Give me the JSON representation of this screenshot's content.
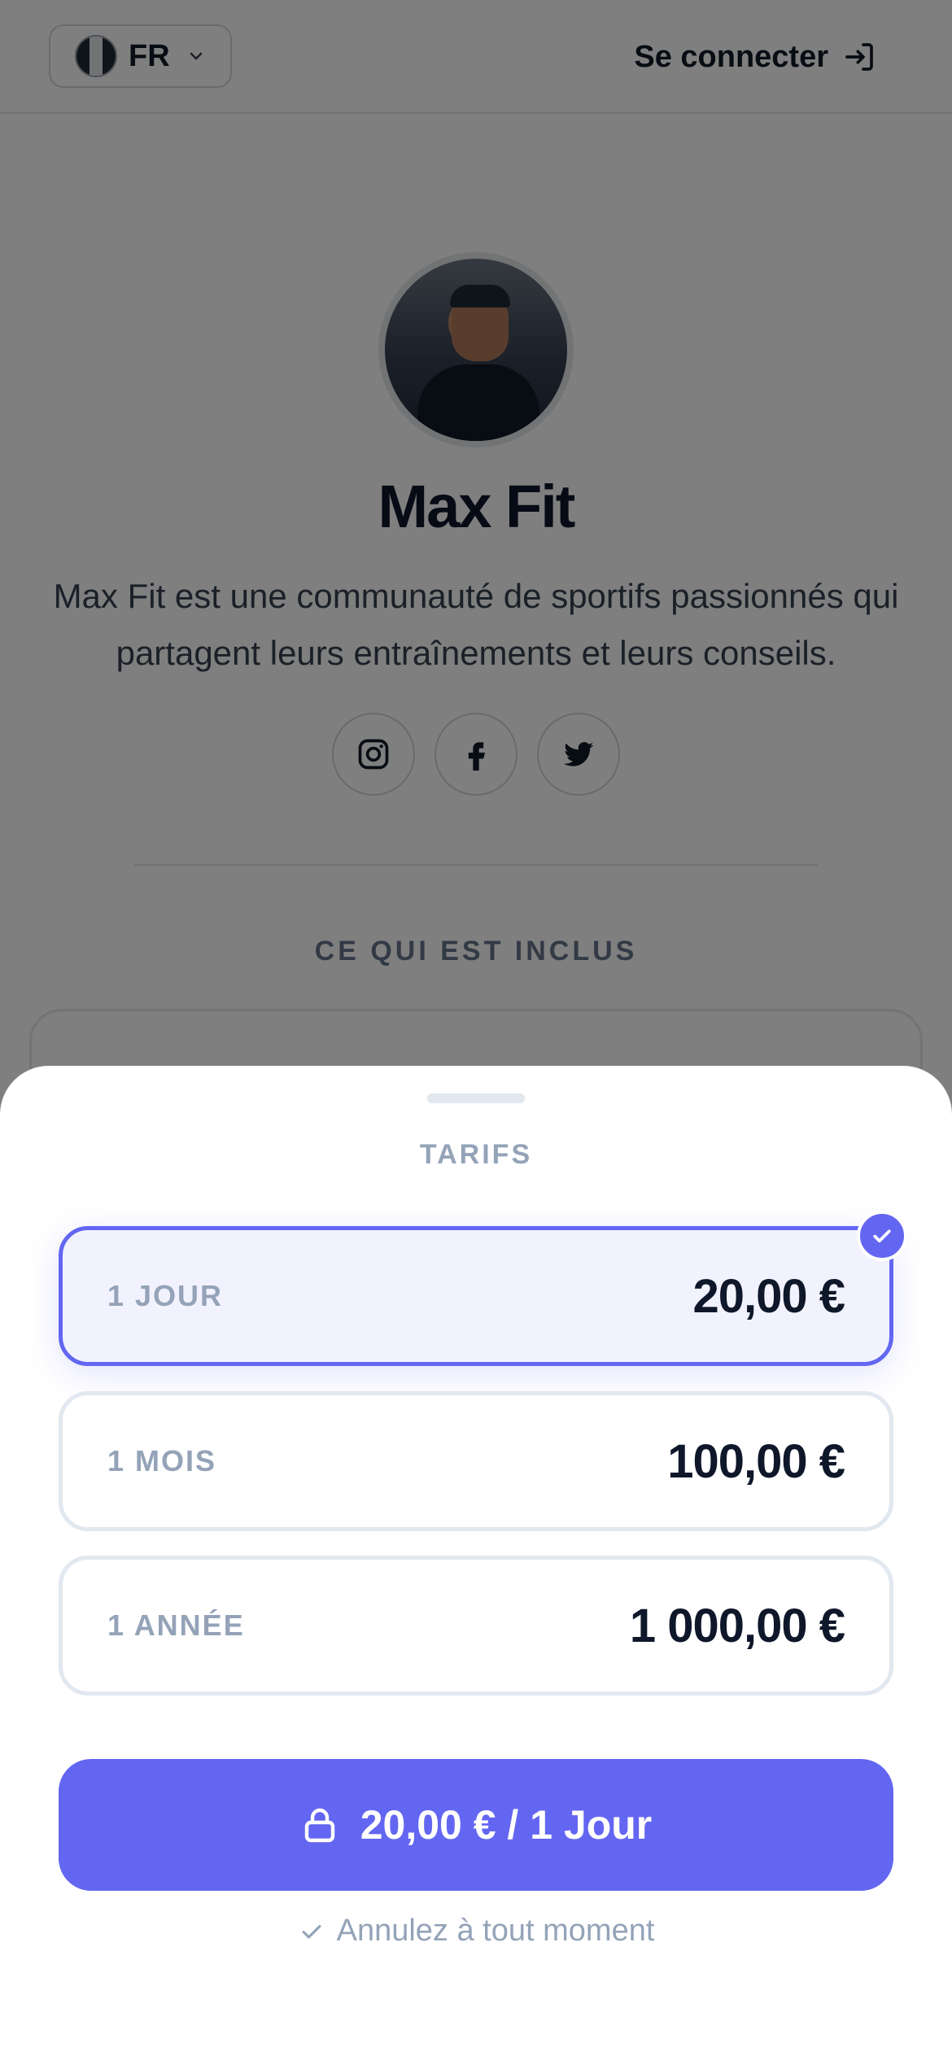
{
  "header": {
    "language_code": "FR",
    "login_label": "Se connecter"
  },
  "profile": {
    "name": "Max Fit",
    "description": "Max Fit est une communauté de sportifs passionnés qui partagent leurs entraînements et leurs conseils.",
    "socials": [
      "instagram-icon",
      "facebook-icon",
      "twitter-icon"
    ]
  },
  "included": {
    "title": "CE QUI EST INCLUS"
  },
  "sheet": {
    "title": "TARIFS",
    "plans": [
      {
        "label": "1 JOUR",
        "price": "20,00 €",
        "selected": true
      },
      {
        "label": "1 MOIS",
        "price": "100,00 €",
        "selected": false
      },
      {
        "label": "1 ANNÉE",
        "price": "1 000,00 €",
        "selected": false
      }
    ],
    "cta_label": "20,00 € / 1 Jour",
    "cancel_note": "Annulez à tout moment"
  },
  "colors": {
    "accent": "#6366f1",
    "selected_bg": "#f1f2fd",
    "muted_text": "#94a3b8",
    "overlay": "rgba(0,0,0,0.5)"
  }
}
